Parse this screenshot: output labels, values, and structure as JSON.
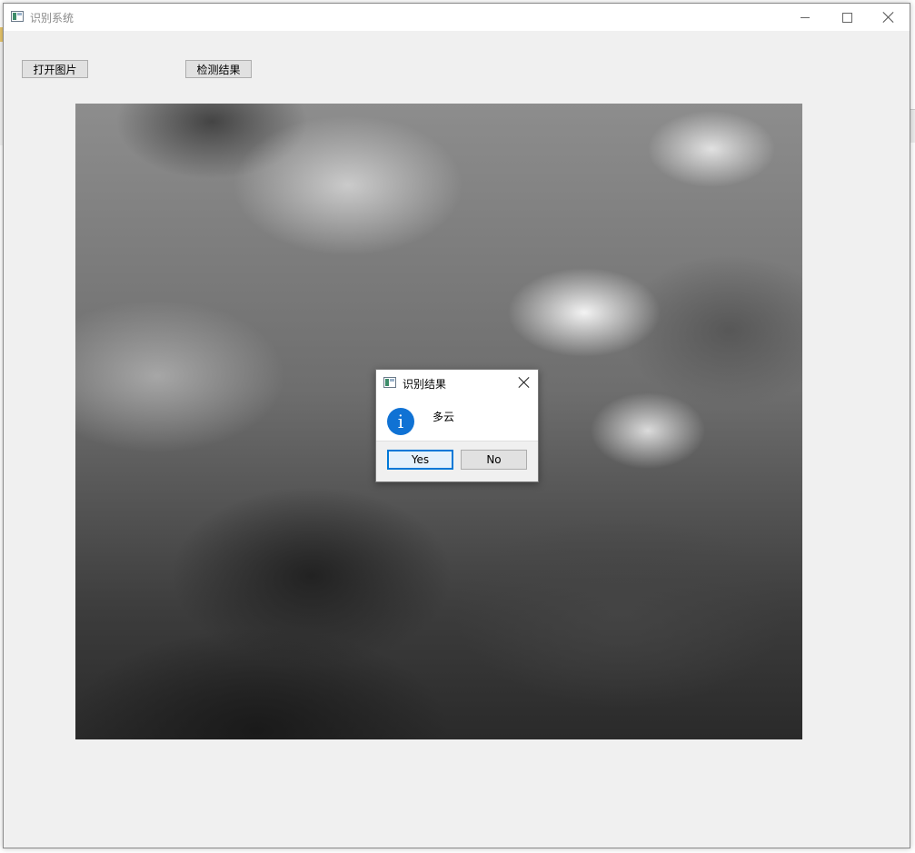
{
  "window": {
    "title": "识别系统",
    "icon": "app-window-icon",
    "controls": [
      "minimize-icon",
      "maximize-icon",
      "close-icon"
    ]
  },
  "toolbar": {
    "open_label": "打开图片",
    "detect_label": "检测结果"
  },
  "image": {
    "description_icon": "cloudy-sky-image"
  },
  "dialog": {
    "title": "识别结果",
    "icon": "information-icon",
    "info_glyph": "i",
    "message": "多云",
    "yes_label": "Yes",
    "no_label": "No",
    "accent_color": "#0078d7"
  }
}
